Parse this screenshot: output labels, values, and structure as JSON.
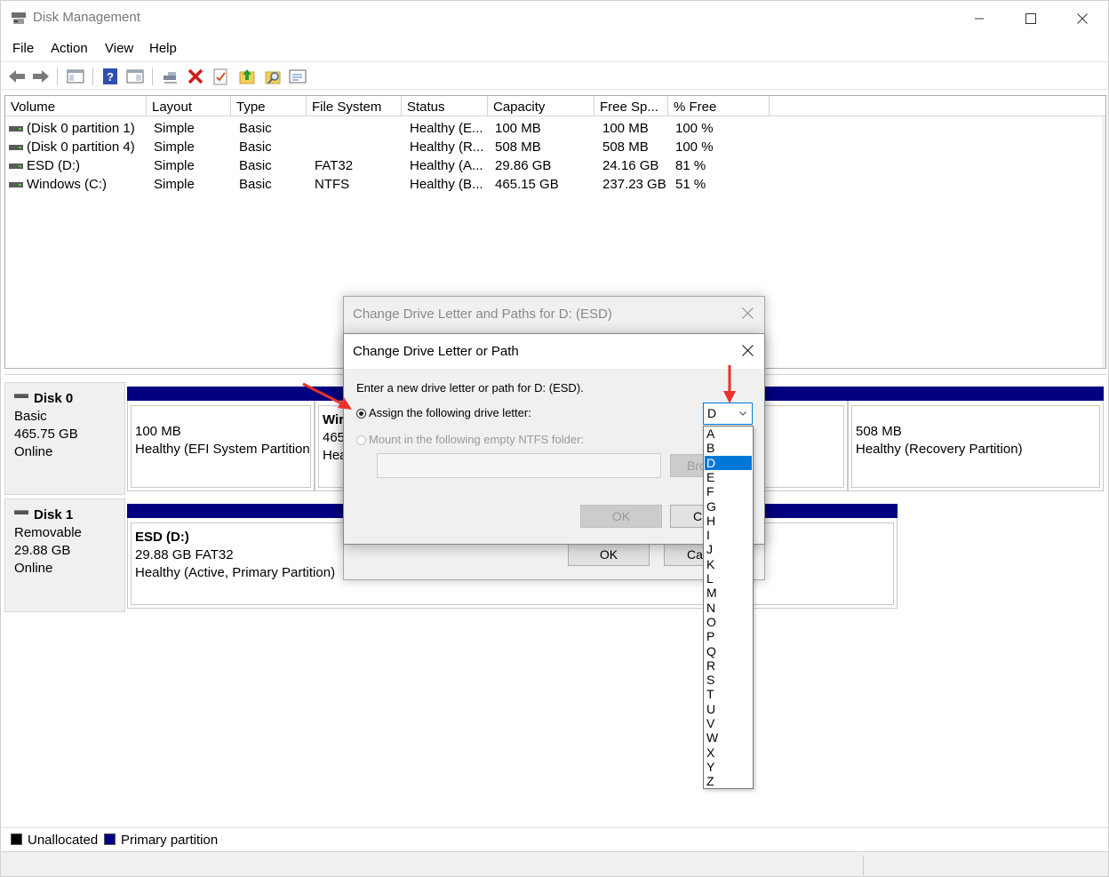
{
  "window": {
    "title": "Disk Management"
  },
  "menu": [
    "File",
    "Action",
    "View",
    "Help"
  ],
  "toolbar": [
    "back-icon",
    "forward-icon",
    "console-tree-icon",
    "help-icon",
    "properties-icon",
    "connect-icon",
    "delete-icon",
    "check-icon",
    "up-icon",
    "search-icon",
    "view-icon"
  ],
  "volume_list": {
    "columns": [
      "Volume",
      "Layout",
      "Type",
      "File System",
      "Status",
      "Capacity",
      "Free Sp...",
      "% Free"
    ],
    "rows": [
      {
        "volume": "(Disk 0 partition 1)",
        "layout": "Simple",
        "type": "Basic",
        "fs": "",
        "status": "Healthy (E...",
        "capacity": "100 MB",
        "free": "100 MB",
        "pct": "100 %"
      },
      {
        "volume": "(Disk 0 partition 4)",
        "layout": "Simple",
        "type": "Basic",
        "fs": "",
        "status": "Healthy (R...",
        "capacity": "508 MB",
        "free": "508 MB",
        "pct": "100 %"
      },
      {
        "volume": "ESD (D:)",
        "layout": "Simple",
        "type": "Basic",
        "fs": "FAT32",
        "status": "Healthy (A...",
        "capacity": "29.86 GB",
        "free": "24.16 GB",
        "pct": "81 %"
      },
      {
        "volume": "Windows (C:)",
        "layout": "Simple",
        "type": "Basic",
        "fs": "NTFS",
        "status": "Healthy (B...",
        "capacity": "465.15 GB",
        "free": "237.23 GB",
        "pct": "51 %"
      }
    ]
  },
  "disks": [
    {
      "name": "Disk 0",
      "type": "Basic",
      "size": "465.75 GB",
      "state": "Online",
      "partitions": [
        {
          "line1": "100 MB",
          "line2": "Healthy (EFI System Partition"
        },
        {
          "line0": "Wir",
          "line1": "465",
          "line2": "Hea"
        },
        {
          "line1": "508 MB",
          "line2": "Healthy (Recovery Partition)"
        }
      ]
    },
    {
      "name": "Disk 1",
      "type": "Removable",
      "size": "29.88 GB",
      "state": "Online",
      "partitions": [
        {
          "line0": "ESD  (D:)",
          "line1": "29.88 GB FAT32",
          "line2": "Healthy (Active, Primary Partition)"
        }
      ]
    }
  ],
  "legend": [
    {
      "label": "Unallocated",
      "color": "#000000"
    },
    {
      "label": "Primary partition",
      "color": "#000080"
    }
  ],
  "outer_dialog": {
    "title": "Change Drive Letter and Paths for D: (ESD)",
    "ok": "OK",
    "cancel": "Ca"
  },
  "inner_dialog": {
    "title": "Change Drive Letter or Path",
    "prompt": "Enter a new drive letter or path for D: (ESD).",
    "assign_label": "Assign the following drive letter:",
    "mount_label": "Mount in the following empty NTFS folder:",
    "browse": "Bro",
    "ok": "OK",
    "cancel": "C",
    "selected_letter": "D",
    "letters": [
      "A",
      "B",
      "D",
      "E",
      "F",
      "G",
      "H",
      "I",
      "J",
      "K",
      "L",
      "M",
      "N",
      "O",
      "P",
      "Q",
      "R",
      "S",
      "T",
      "U",
      "V",
      "W",
      "X",
      "Y",
      "Z"
    ]
  },
  "colors": {
    "primary": "#000080",
    "selection": "#0078d7",
    "annotation": "#e8332a"
  }
}
